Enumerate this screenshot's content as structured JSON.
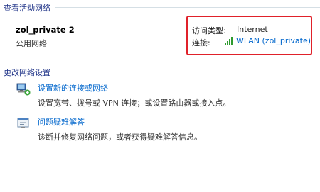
{
  "active_networks": {
    "header": "查看活动网络",
    "name": "zol_private 2",
    "type": "公用网络",
    "access_type_label": "访问类型:",
    "access_type_value": "Internet",
    "connection_label": "连接:",
    "connection_value": "WLAN (zol_private)"
  },
  "change_settings": {
    "header": "更改网络设置",
    "tasks": [
      {
        "title": "设置新的连接或网络",
        "description": "设置宽带、拨号或 VPN 连接；或设置路由器或接入点。",
        "icon": "network-setup-icon"
      },
      {
        "title": "问题疑难解答",
        "description": "诊断并修复网络问题，或者获得疑难解答信息。",
        "icon": "troubleshoot-icon"
      }
    ]
  },
  "colors": {
    "header": "#1e3287",
    "link": "#0066cc",
    "highlight": "#e0212a"
  }
}
